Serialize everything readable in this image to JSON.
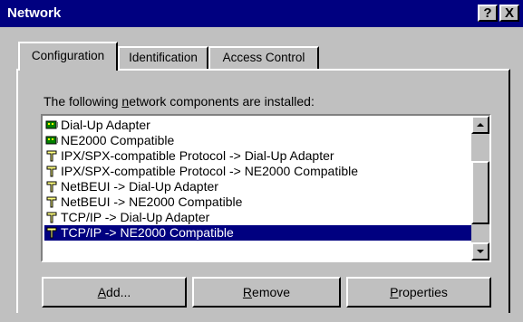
{
  "window": {
    "title": "Network",
    "help_glyph": "?",
    "close_glyph": "X"
  },
  "tabs": [
    {
      "label": "Configuration",
      "active": true
    },
    {
      "label": "Identification",
      "active": false
    },
    {
      "label": "Access Control",
      "active": false
    }
  ],
  "components_label": {
    "before": "The following ",
    "underlined": "n",
    "after": "etwork components are installed:"
  },
  "components": [
    {
      "label": "Dial-Up Adapter",
      "icon": "adapter-icon",
      "selected": false
    },
    {
      "label": "NE2000 Compatible",
      "icon": "adapter-icon",
      "selected": false
    },
    {
      "label": "IPX/SPX-compatible Protocol -> Dial-Up Adapter",
      "icon": "protocol-icon",
      "selected": false
    },
    {
      "label": "IPX/SPX-compatible Protocol -> NE2000 Compatible",
      "icon": "protocol-icon",
      "selected": false
    },
    {
      "label": "NetBEUI -> Dial-Up Adapter",
      "icon": "protocol-icon",
      "selected": false
    },
    {
      "label": "NetBEUI -> NE2000 Compatible",
      "icon": "protocol-icon",
      "selected": false
    },
    {
      "label": "TCP/IP -> Dial-Up Adapter",
      "icon": "protocol-icon",
      "selected": false
    },
    {
      "label": "TCP/IP -> NE2000 Compatible",
      "icon": "protocol-icon",
      "selected": true
    }
  ],
  "buttons": {
    "add": {
      "underlined": "A",
      "rest": "dd..."
    },
    "remove": {
      "underlined": "R",
      "rest": "emove"
    },
    "properties": {
      "underlined": "P",
      "rest": "roperties"
    }
  },
  "colors": {
    "titlebar": "#000080",
    "face": "#c0c0c0",
    "selection": "#000080"
  }
}
